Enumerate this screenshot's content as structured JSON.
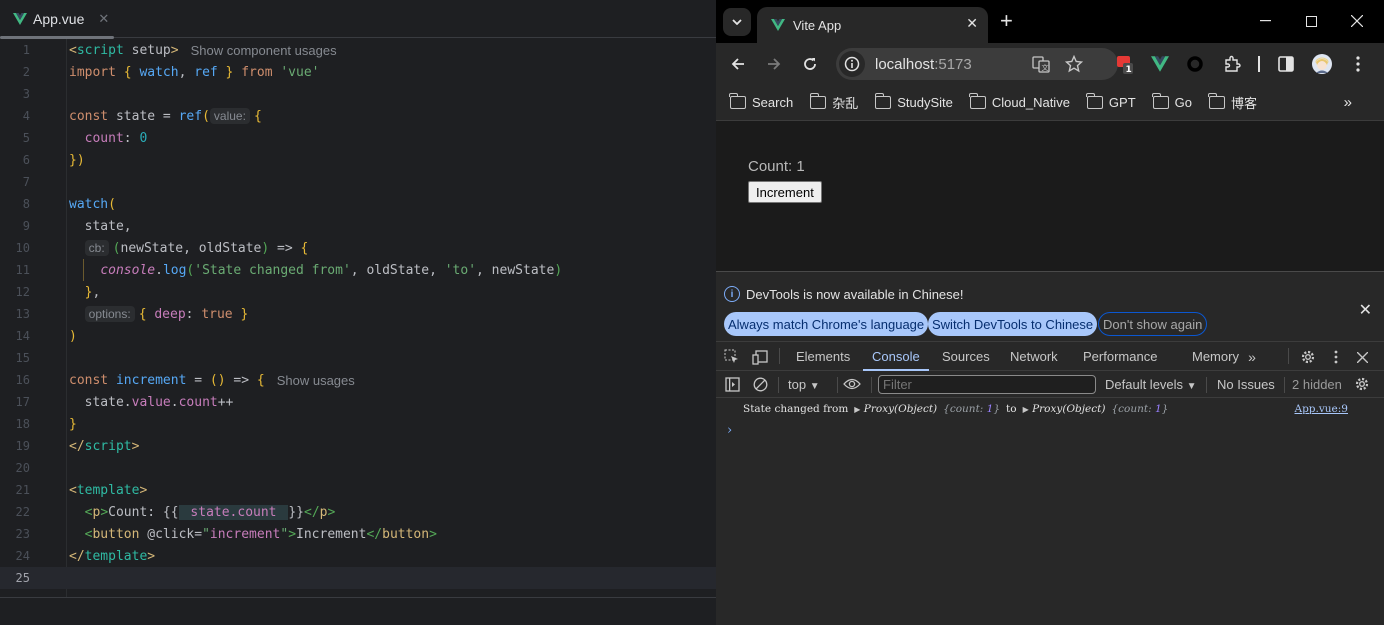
{
  "ide": {
    "tab": {
      "name": "App.vue",
      "icon": "vue-icon"
    },
    "lines": [
      {
        "n": "1"
      },
      {
        "n": "2"
      },
      {
        "n": "3"
      },
      {
        "n": "4"
      },
      {
        "n": "5"
      },
      {
        "n": "6"
      },
      {
        "n": "7"
      },
      {
        "n": "8"
      },
      {
        "n": "9"
      },
      {
        "n": "10"
      },
      {
        "n": "11"
      },
      {
        "n": "12"
      },
      {
        "n": "13"
      },
      {
        "n": "14"
      },
      {
        "n": "15"
      },
      {
        "n": "16"
      },
      {
        "n": "17"
      },
      {
        "n": "18"
      },
      {
        "n": "19"
      },
      {
        "n": "20"
      },
      {
        "n": "21"
      },
      {
        "n": "22"
      },
      {
        "n": "23"
      },
      {
        "n": "24"
      },
      {
        "n": "25"
      }
    ],
    "code": {
      "l1": {
        "open": "<",
        "tag": "script",
        "attr": " setup",
        "close": ">",
        "hint": "Show component usages"
      },
      "l2": {
        "kw": "import",
        "b1": " { ",
        "fn1": "watch",
        "comma": ", ",
        "fn2": "ref",
        "b2": " } ",
        "kw2": "from ",
        "str": "'vue'"
      },
      "l4": {
        "kw": "const",
        "var": " state = ",
        "fn": "ref",
        "paren": "(",
        "inlay": "value:",
        "brace": "{"
      },
      "l5": {
        "prop": "count",
        "colon": ": ",
        "num": "0"
      },
      "l6": {
        "text": "})"
      },
      "l8": {
        "fn": "watch",
        "paren": "("
      },
      "l9": {
        "text": "state,"
      },
      "l10": {
        "inlay": "cb:",
        "p1": "(",
        "args": "newState, oldState",
        "p2": ")",
        "arrow": " => ",
        "brace": "{"
      },
      "l11": {
        "obj": "console",
        "dot": ".",
        "fn": "log",
        "p1": "(",
        "s1": "'State changed from'",
        "mid1": ", oldState, ",
        "s2": "'to'",
        "mid2": ", newState",
        "p2": ")"
      },
      "l12": {
        "brace": "}",
        "comma": ","
      },
      "l13": {
        "inlay": "options:",
        "b1": "{ ",
        "prop": "deep",
        "colon": ": ",
        "kw": "true",
        "b2": " }"
      },
      "l14": {
        "paren": ")"
      },
      "l16": {
        "kw": "const",
        "fn": " increment",
        "eq": " = ",
        "parens": "()",
        "arrow": " => ",
        "brace": "{",
        "hint": "Show usages"
      },
      "l17": {
        "a": "state.",
        "p1": "value",
        "dot": ".",
        "p2": "count",
        "op": "++"
      },
      "l18": {
        "brace": "}"
      },
      "l19": {
        "open": "</",
        "tag": "script",
        "close": ">"
      },
      "l21": {
        "open": "<",
        "tag": "template",
        "close": ">"
      },
      "l22": {
        "o1": "<",
        "t1": "p",
        "c1": ">",
        "txt": "Count: {{",
        "expr": " state.count ",
        "txt2": "}}",
        "o2": "</",
        "t2": "p",
        "c2": ">"
      },
      "l23": {
        "o1": "<",
        "t1": "button",
        "attr": " @click=",
        "q1": "\"",
        "val": "increment",
        "q2": "\"",
        "c1": ">",
        "txt": "Increment",
        "o2": "</",
        "t2": "button",
        "c2": ">"
      },
      "l24": {
        "open": "</",
        "tag": "template",
        "close": ">"
      }
    }
  },
  "browser": {
    "tab": {
      "title": "Vite App"
    },
    "url": {
      "host": "localhost",
      "port": ":5173"
    },
    "extensions_badge": "1",
    "bookmarks": [
      {
        "label": "Search"
      },
      {
        "label": "杂乱"
      },
      {
        "label": "StudySite"
      },
      {
        "label": "Cloud_Native"
      },
      {
        "label": "GPT"
      },
      {
        "label": "Go"
      },
      {
        "label": "博客"
      }
    ],
    "page": {
      "count_text": "Count: 1",
      "button_label": "Increment"
    },
    "devtools": {
      "infobar": {
        "message": "DevTools is now available in Chinese!",
        "btn_always": "Always match Chrome's language",
        "btn_switch": "Switch DevTools to Chinese",
        "btn_dont": "Don't show again"
      },
      "tabs": [
        {
          "label": "Elements"
        },
        {
          "label": "Console"
        },
        {
          "label": "Sources"
        },
        {
          "label": "Network"
        },
        {
          "label": "Performance"
        },
        {
          "label": "Memory"
        }
      ],
      "console_bar": {
        "context": "top",
        "filter_placeholder": "Filter",
        "levels": "Default levels",
        "issues": "No Issues",
        "hidden": "2 hidden"
      },
      "log": {
        "text1": "State changed from",
        "proxy1": "Proxy(Object)",
        "preview1_key": "{count: ",
        "preview1_val": "1",
        "preview1_end": "}",
        "text2": "to",
        "proxy2": "Proxy(Object)",
        "preview2_key": "{count: ",
        "preview2_val": "1",
        "preview2_end": "}",
        "source": "App.vue:9"
      },
      "prompt": "›"
    }
  }
}
